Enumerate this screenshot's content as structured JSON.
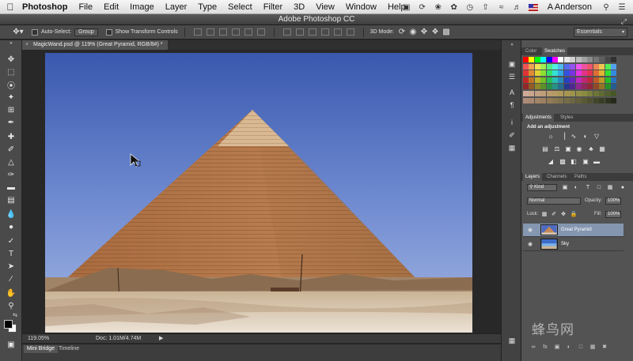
{
  "menubar": {
    "app_name": "Photoshop",
    "items": [
      "File",
      "Edit",
      "Image",
      "Layer",
      "Type",
      "Select",
      "Filter",
      "3D",
      "View",
      "Window",
      "Help"
    ],
    "user": "A Anderson"
  },
  "window": {
    "title": "Adobe Photoshop CC"
  },
  "options": {
    "auto_select_label": "Auto-Select:",
    "auto_select_value": "Group",
    "transform_label": "Show Transform Controls",
    "mode_3d_label": "3D Mode:",
    "workspace": "Essentials"
  },
  "document": {
    "tab_title": "MagicWand.psd @ 119% (Great Pyramid, RGB/8#) *"
  },
  "status": {
    "zoom": "119.05%",
    "doc_size": "Doc: 1.01M/4.74M"
  },
  "bottom_tabs": [
    "Mini Bridge",
    "Timeline"
  ],
  "panels": {
    "color_tabs": [
      "Color",
      "Swatches"
    ],
    "adjust_tabs": [
      "Adjustments",
      "Styles"
    ],
    "adjust_title": "Add an adjustment",
    "layers_tabs": [
      "Layers",
      "Channels",
      "Paths"
    ],
    "kind_label": "Kind",
    "blend_mode": "Normal",
    "opacity_label": "Opacity:",
    "opacity_value": "100%",
    "lock_label": "Lock:",
    "fill_label": "Fill:",
    "fill_value": "100%",
    "layers": [
      {
        "name": "Great Pyramid",
        "selected": true
      },
      {
        "name": "Sky",
        "selected": false
      }
    ]
  },
  "watermark": "蜂鸟网",
  "colors": {
    "accent_selected_layer": "#8496b0",
    "sky_top": "#3b5bb0",
    "sand": "#d9c8b0"
  }
}
